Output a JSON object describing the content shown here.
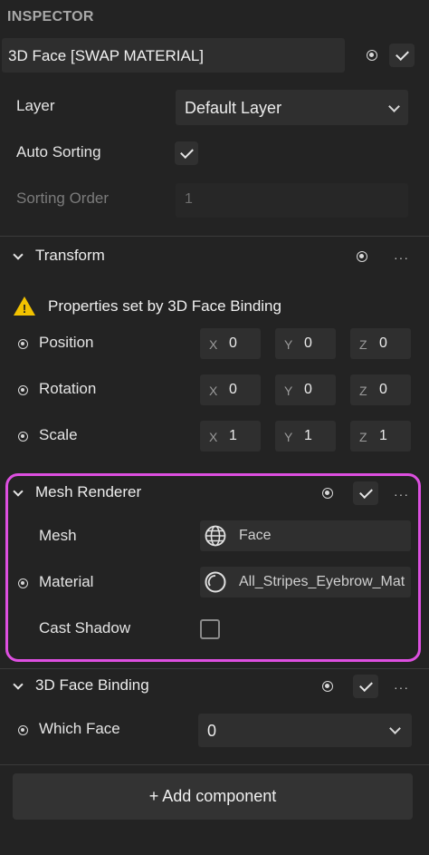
{
  "inspector": {
    "title": "INSPECTOR",
    "object_name": "3D Face [SWAP MATERIAL]",
    "layer_label": "Layer",
    "layer_value": "Default Layer",
    "auto_sorting_label": "Auto Sorting",
    "auto_sorting_checked": true,
    "sorting_order_label": "Sorting Order",
    "sorting_order_value": "1"
  },
  "transform": {
    "title": "Transform",
    "more": "···",
    "warning": "Properties set by 3D Face Binding",
    "rows": [
      {
        "label": "Position",
        "x": "0",
        "y": "0",
        "z": "0"
      },
      {
        "label": "Rotation",
        "x": "0",
        "y": "0",
        "z": "0"
      },
      {
        "label": "Scale",
        "x": "1",
        "y": "1",
        "z": "1"
      }
    ],
    "axis": {
      "x": "X",
      "y": "Y",
      "z": "Z"
    }
  },
  "mesh_renderer": {
    "title": "Mesh Renderer",
    "more": "···",
    "mesh_label": "Mesh",
    "mesh_value": "Face",
    "material_label": "Material",
    "material_value": "All_Stripes_Eyebrow_Mat",
    "cast_shadow_label": "Cast Shadow",
    "cast_shadow_checked": false
  },
  "face_binding": {
    "title": "3D Face Binding",
    "more": "···",
    "which_face_label": "Which Face",
    "which_face_value": "0"
  },
  "add_component_label": "+ Add component",
  "colors": {
    "background": "#232323",
    "highlight": "#dd4fe0",
    "warning": "#f2c200"
  }
}
